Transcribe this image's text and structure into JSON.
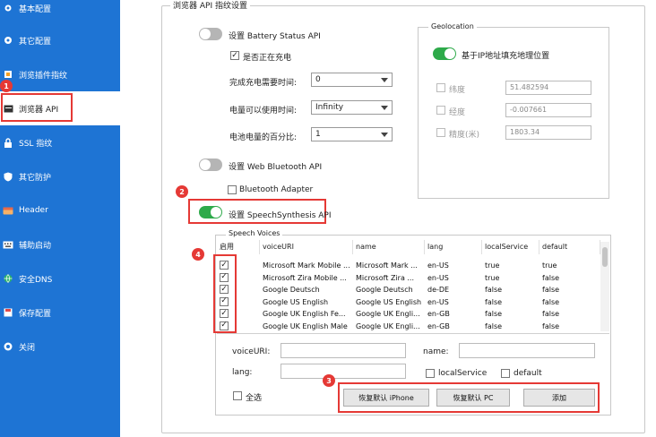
{
  "sidebar": {
    "items": [
      {
        "label": "基本配置",
        "icon": "gear-icon"
      },
      {
        "label": "其它配置",
        "icon": "sliders-icon"
      },
      {
        "label": "浏览插件指纹",
        "icon": "plugin-icon"
      },
      {
        "label": "浏览器 API",
        "icon": "api-icon"
      },
      {
        "label": "SSL 指纹",
        "icon": "lock-icon"
      },
      {
        "label": "其它防护",
        "icon": "shield-icon"
      },
      {
        "label": "Header",
        "icon": "header-icon"
      },
      {
        "label": "辅助启动",
        "icon": "keyboard-icon"
      },
      {
        "label": "安全DNS",
        "icon": "globe-icon"
      },
      {
        "label": "保存配置",
        "icon": "save-icon"
      },
      {
        "label": "关闭",
        "icon": "power-icon"
      }
    ]
  },
  "badges": {
    "b1": "1",
    "b2": "2",
    "b3": "3",
    "b4": "4"
  },
  "section": {
    "title": "浏览器 API 指纹设置"
  },
  "battery": {
    "toggle_label": "设置 Battery Status API",
    "charging_label": "是否正在充电",
    "charge_time_label": "完成充电需要时间:",
    "charge_time_value": "0",
    "discharge_label": "电量可以使用时间:",
    "discharge_value": "Infinity",
    "level_label": "电池电量的百分比:",
    "level_value": "1"
  },
  "bluetooth": {
    "toggle_label": "设置 Web Bluetooth API",
    "adapter_label": "Bluetooth Adapter"
  },
  "speech": {
    "toggle_label": "设置 SpeechSynthesis API",
    "group_title": "Speech Voices",
    "columns": [
      "启用",
      "voiceURI",
      "name",
      "lang",
      "localService",
      "default"
    ],
    "rows": [
      {
        "voiceURI": "Microsoft Mark Mobile ...",
        "name": "Microsoft Mark ...",
        "lang": "en-US",
        "local": "true",
        "default": "true"
      },
      {
        "voiceURI": "Microsoft Zira Mobile ...",
        "name": "Microsoft Zira ...",
        "lang": "en-US",
        "local": "true",
        "default": "false"
      },
      {
        "voiceURI": "Google Deutsch",
        "name": "Google Deutsch",
        "lang": "de-DE",
        "local": "false",
        "default": "false"
      },
      {
        "voiceURI": "Google US English",
        "name": "Google US English",
        "lang": "en-US",
        "local": "false",
        "default": "false"
      },
      {
        "voiceURI": "Google UK English Fe...",
        "name": "Google UK Engli...",
        "lang": "en-GB",
        "local": "false",
        "default": "false"
      },
      {
        "voiceURI": "Google UK English Male",
        "name": "Google UK Engli...",
        "lang": "en-GB",
        "local": "false",
        "default": "false"
      }
    ],
    "form": {
      "voiceuri_label": "voiceURI:",
      "name_label": "name:",
      "lang_label": "lang:",
      "local_label": "localService",
      "default_label": "default",
      "select_all_label": "全选",
      "btn_iphone": "恢复默认 iPhone",
      "btn_pc": "恢复默认 PC",
      "btn_add": "添加"
    }
  },
  "geolocation": {
    "title": "Geolocation",
    "toggle_label": "基于IP地址填充地理位置",
    "lat_label": "纬度",
    "lat_value": "51.482594",
    "lng_label": "经度",
    "lng_value": "-0.007661",
    "acc_label": "精度(米)",
    "acc_value": "1803.34"
  },
  "colors": {
    "sidebar": "#1e74d4",
    "toggle_on": "#2eaa4a",
    "highlight": "#e53935"
  }
}
